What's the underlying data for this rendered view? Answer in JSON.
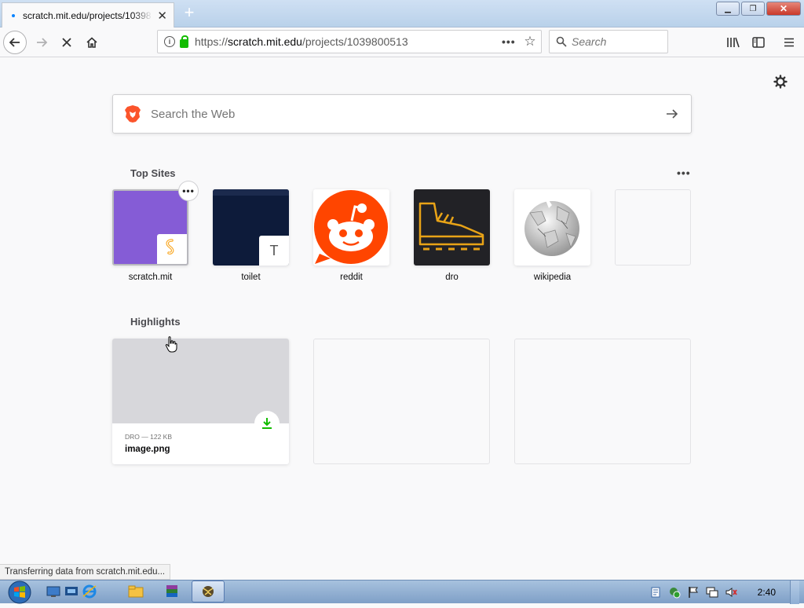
{
  "browser": {
    "tab": {
      "title": "scratch.mit.edu/projects/10398"
    },
    "url": {
      "prefix": "https://",
      "host": "scratch.mit.edu",
      "path": "/projects/1039800513"
    },
    "search_placeholder": "Search",
    "icons": [
      "back-icon",
      "forward-icon",
      "stop-icon",
      "home-icon",
      "info-icon",
      "lock-icon",
      "page-actions-icon",
      "bookmark-star-icon",
      "search-icon",
      "library-icon",
      "sidebar-icon",
      "menu-icon"
    ]
  },
  "newtab": {
    "search_placeholder": "Search the Web",
    "top_sites_title": "Top Sites",
    "highlights_title": "Highlights",
    "top_sites": [
      {
        "label": "scratch.mit",
        "bg": "#855cd6"
      },
      {
        "label": "toilet",
        "bg": "#0d1b3a",
        "corner_letter": "T"
      },
      {
        "label": "reddit",
        "bg": "#ff4500"
      },
      {
        "label": "dro",
        "bg": "#222226"
      },
      {
        "label": "wikipedia",
        "bg": "#ffffff"
      }
    ],
    "highlight": {
      "meta": "DRO — 122 KB",
      "name": "image.png"
    }
  },
  "status_text": "Transferring data from scratch.mit.edu...",
  "taskbar": {
    "time": "2:40"
  },
  "colors": {
    "accent": "#0a84ff",
    "secure": "#12bc00",
    "download": "#12bc00"
  }
}
